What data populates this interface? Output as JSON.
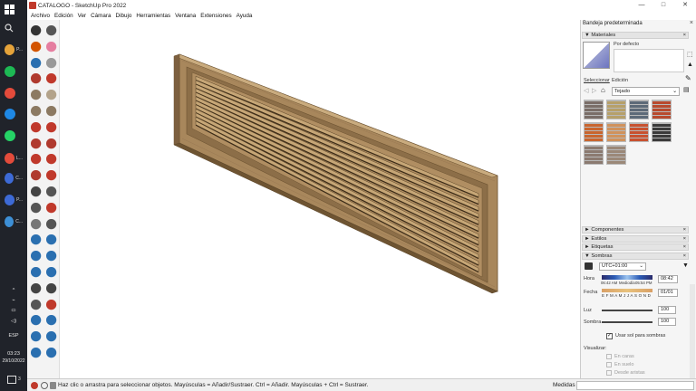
{
  "taskbar": {
    "apps": [
      {
        "label": "P...",
        "color": "#e5a33a"
      },
      {
        "label": "",
        "color": "#1db954"
      },
      {
        "label": "",
        "color": "#e34b3b"
      },
      {
        "label": "",
        "color": "#1e88e5"
      },
      {
        "label": "",
        "color": "#25d366"
      },
      {
        "label": "L...",
        "color": "#e34b3b"
      },
      {
        "label": "C...",
        "color": "#3d6ad6"
      },
      {
        "label": "P...",
        "color": "#3d6ad6"
      },
      {
        "label": "C...",
        "color": "#3d8fd6"
      }
    ],
    "lang": "ESP",
    "time": "03:23",
    "date": "29/10/2022",
    "notif_count": "3"
  },
  "window": {
    "title": "CATALOGO - SketchUp Pro 2022",
    "minimize": "—",
    "maximize": "□",
    "close": "✕"
  },
  "menu": [
    "Archivo",
    "Edición",
    "Ver",
    "Cámara",
    "Dibujo",
    "Herramientas",
    "Ventana",
    "Extensiones",
    "Ayuda"
  ],
  "tray": {
    "title": "Bandeja predeterminada",
    "materials": {
      "header": "Materiales",
      "default_label": "Por defecto",
      "tab_select": "Seleccionar",
      "tab_edit": "Edición",
      "library": "Tejado",
      "swatch_colors": [
        "#7a6e68",
        "#b6a06a",
        "#5d6a78",
        "#b84a2e",
        "#c9652e",
        "#d0925c",
        "#c8512f",
        "#3b3a3a",
        "#8b7a70",
        "#9b8878"
      ]
    },
    "sections": [
      "Componentes",
      "Estilos",
      "Etiquetas",
      "Sombras"
    ],
    "shadows": {
      "utc": "UTC+01:00",
      "hora_label": "Hora",
      "hora_start": "06:42 AM",
      "hora_mid": "Mediodía",
      "hora_end": "05:54 PM",
      "hora_value": "08:42",
      "fecha_label": "Fecha",
      "months": "E F M A M J J A S O N D",
      "fecha_value": "01/01",
      "luz_label": "Luz",
      "luz_value": "100",
      "sombra_label": "Sombra",
      "sombra_value": "100",
      "use_sun": "Usar sol para sombras",
      "visualizar": "Visualizar:",
      "en_caras": "En caras",
      "en_suelo": "En suelo",
      "desde_aristas": "Desde aristas"
    }
  },
  "status": {
    "hint": "Haz clic o arrastra para seleccionar objetos. Mayúsculas = Añadir/Sustraer. Ctrl = Añadir. Mayúsculas + Ctrl = Sustraer.",
    "measure_label": "Medidas",
    "measure_value": ""
  },
  "colors": {
    "wood": "#a8875c",
    "wood_dark": "#6e5432",
    "wood_light": "#c9ab7e",
    "taskbar": "#20232a",
    "accent": "#1e6fd9"
  }
}
